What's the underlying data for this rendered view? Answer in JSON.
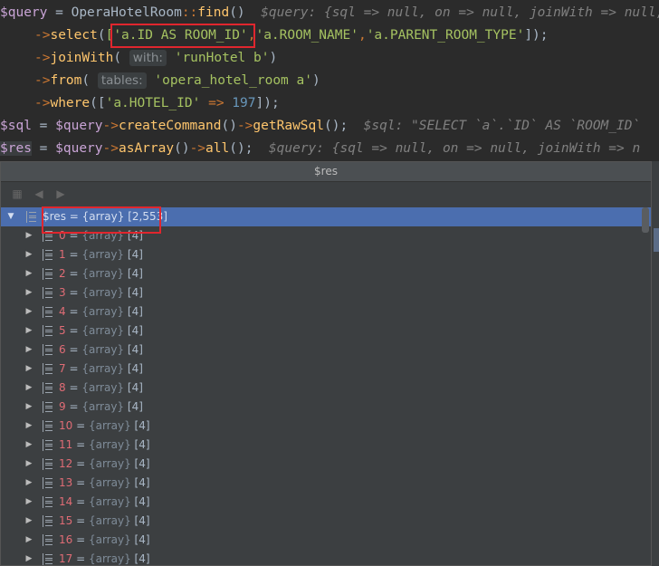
{
  "code": {
    "l1": {
      "var": "$query",
      "eq": " = ",
      "cls": "OperaHotelRoom",
      "dc": "::",
      "fn": "find",
      "paren": "()",
      "comment": "  $query: {sql => null, on => null, joinWith => null,"
    },
    "l2": {
      "arrow": "->",
      "fn": "select",
      "open": "(",
      "s1": "['a.ID AS ROOM_ID'",
      "comma1": ",",
      "s2": "'a.ROOM_NAME'",
      "comma2": ",",
      "s3": "'a.PARENT_ROOM_TYPE'",
      "close": "]);"
    },
    "l3": {
      "arrow": "->",
      "fn": "joinWith",
      "open": "( ",
      "hint": "with:",
      "str": " 'runHotel b'",
      "close": ")"
    },
    "l4": {
      "arrow": "->",
      "fn": "from",
      "open": "( ",
      "hint": "tables:",
      "str": " 'opera_hotel_room a'",
      "close": ")"
    },
    "l5": {
      "arrow": "->",
      "fn": "where",
      "open": "([",
      "str": "'a.HOTEL_ID'",
      "op": " => ",
      "num": "197",
      "close": "]);"
    },
    "l6": {
      "var": "$sql",
      "eq": " = ",
      "var2": "$query",
      "arrow1": "->",
      "fn1": "createCommand",
      "p1": "()",
      "arrow2": "->",
      "fn2": "getRawSql",
      "p2": "();",
      "comment": "  $sql: \"SELECT `a`.`ID` AS `ROOM_ID`"
    },
    "l7": {
      "var": "$res",
      "eq": " = ",
      "var2": "$query",
      "arrow1": "->",
      "fn1": "asArray",
      "p1": "()",
      "arrow2": "->",
      "fn2": "all",
      "p2": "();",
      "comment": "  $query: {sql => null, on => null, joinWith => n"
    }
  },
  "panel": {
    "title": "$res"
  },
  "tree": {
    "root": {
      "name": "$res",
      "eq": " = ",
      "type": "{array}",
      "count": "[2,553]"
    },
    "items": [
      {
        "name": "0",
        "eq": " = ",
        "type": "{array}",
        "count": "[4]"
      },
      {
        "name": "1",
        "eq": " = ",
        "type": "{array}",
        "count": "[4]"
      },
      {
        "name": "2",
        "eq": " = ",
        "type": "{array}",
        "count": "[4]"
      },
      {
        "name": "3",
        "eq": " = ",
        "type": "{array}",
        "count": "[4]"
      },
      {
        "name": "4",
        "eq": " = ",
        "type": "{array}",
        "count": "[4]"
      },
      {
        "name": "5",
        "eq": " = ",
        "type": "{array}",
        "count": "[4]"
      },
      {
        "name": "6",
        "eq": " = ",
        "type": "{array}",
        "count": "[4]"
      },
      {
        "name": "7",
        "eq": " = ",
        "type": "{array}",
        "count": "[4]"
      },
      {
        "name": "8",
        "eq": " = ",
        "type": "{array}",
        "count": "[4]"
      },
      {
        "name": "9",
        "eq": " = ",
        "type": "{array}",
        "count": "[4]"
      },
      {
        "name": "10",
        "eq": " = ",
        "type": "{array}",
        "count": "[4]"
      },
      {
        "name": "11",
        "eq": " = ",
        "type": "{array}",
        "count": "[4]"
      },
      {
        "name": "12",
        "eq": " = ",
        "type": "{array}",
        "count": "[4]"
      },
      {
        "name": "13",
        "eq": " = ",
        "type": "{array}",
        "count": "[4]"
      },
      {
        "name": "14",
        "eq": " = ",
        "type": "{array}",
        "count": "[4]"
      },
      {
        "name": "15",
        "eq": " = ",
        "type": "{array}",
        "count": "[4]"
      },
      {
        "name": "16",
        "eq": " = ",
        "type": "{array}",
        "count": "[4]"
      },
      {
        "name": "17",
        "eq": " = ",
        "type": "{array}",
        "count": "[4]"
      }
    ]
  },
  "colors": {
    "background": "#2b2b2b",
    "selection": "#4b6eaf",
    "highlight_box": "#e0262e"
  }
}
